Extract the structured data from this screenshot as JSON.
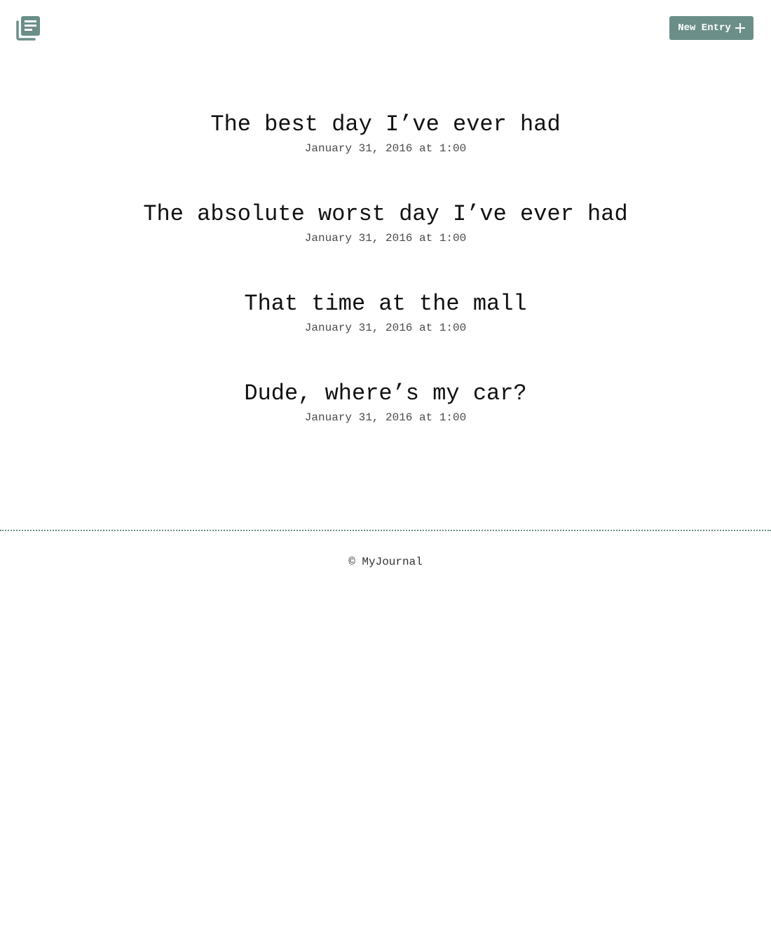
{
  "header": {
    "logo_icon": "journal-icon",
    "new_entry_label": "New Entry",
    "new_entry_icon": "plus-icon",
    "accent_color": "#6b8e88"
  },
  "entries": [
    {
      "title": "The best day I’ve ever had",
      "date": "January 31, 2016 at 1:00"
    },
    {
      "title": "The absolute worst day I’ve ever had",
      "date": "January 31, 2016 at 1:00"
    },
    {
      "title": "That time at the mall",
      "date": "January 31, 2016 at 1:00"
    },
    {
      "title": "Dude, where’s my car?",
      "date": "January 31, 2016 at 1:00"
    }
  ],
  "footer": {
    "text": "© MyJournal"
  }
}
